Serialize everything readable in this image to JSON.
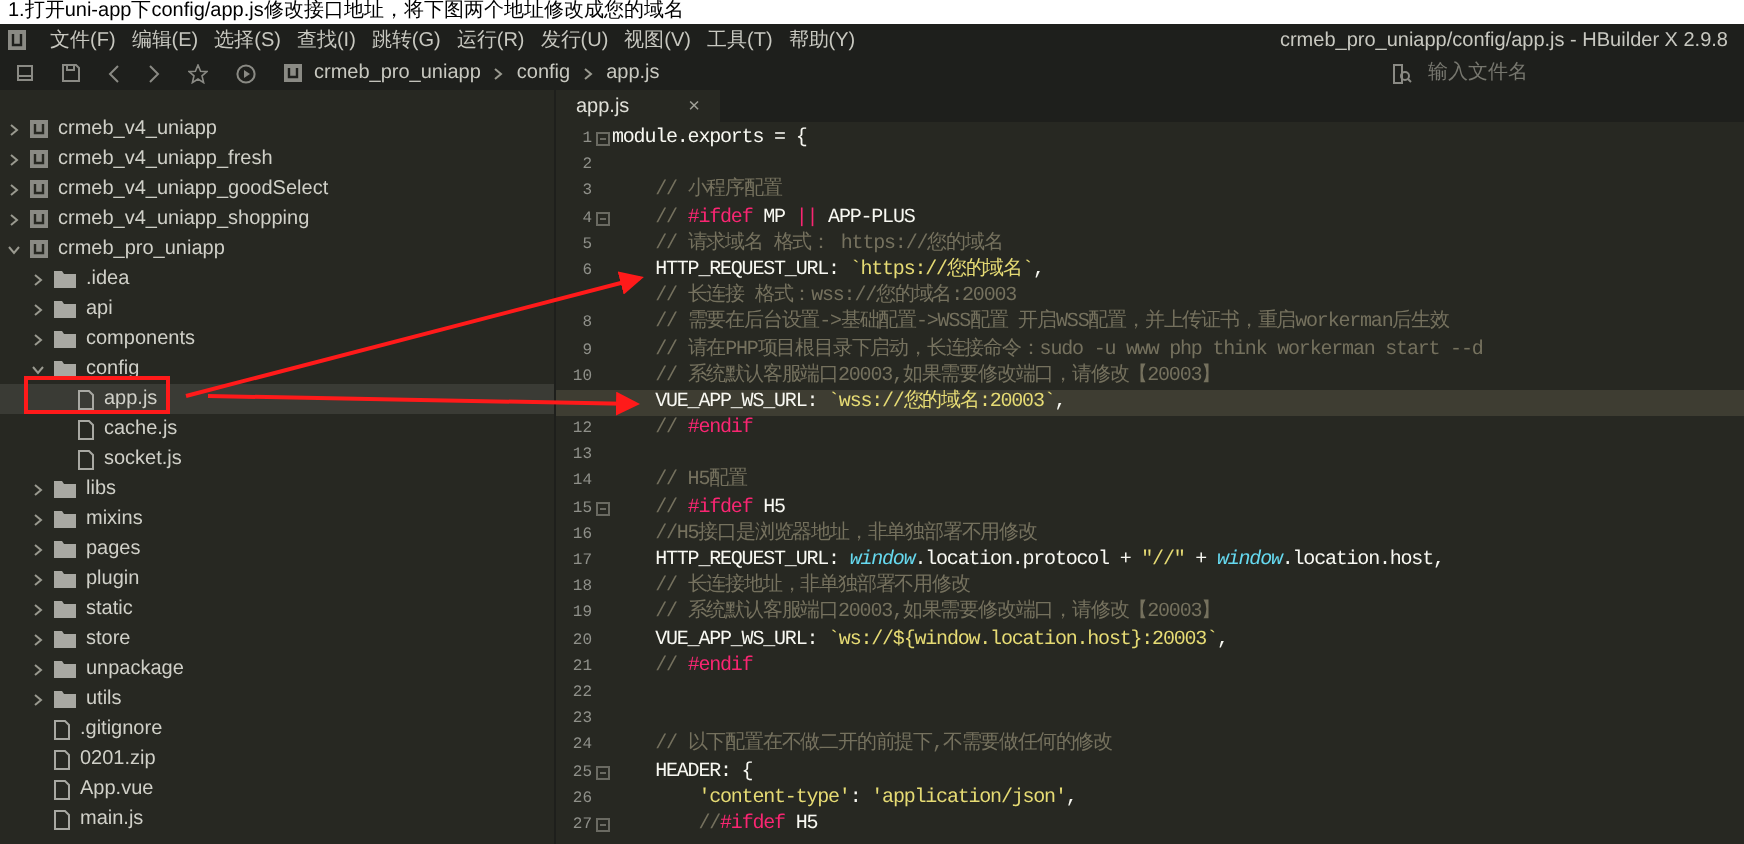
{
  "caption": "1.打开uni-app下config/app.js修改接口地址，将下图两个地址修改成您的域名",
  "menu": [
    "文件(F)",
    "编辑(E)",
    "选择(S)",
    "查找(I)",
    "跳转(G)",
    "运行(R)",
    "发行(U)",
    "视图(V)",
    "工具(T)",
    "帮助(Y)"
  ],
  "window": {
    "title": "crmeb_pro_uniapp/config/app.js - HBuilder X 2.9.8"
  },
  "breadcrumb": [
    "crmeb_pro_uniapp",
    "config",
    "app.js"
  ],
  "file_search": {
    "placeholder": "输入文件名"
  },
  "tree": [
    {
      "kind": "project",
      "label": "crmeb_v4_uniapp",
      "expanded": false,
      "selected": false
    },
    {
      "kind": "project",
      "label": "crmeb_v4_uniapp_fresh",
      "expanded": false,
      "selected": false
    },
    {
      "kind": "project",
      "label": "crmeb_v4_uniapp_goodSelect",
      "expanded": false,
      "selected": false
    },
    {
      "kind": "project",
      "label": "crmeb_v4_uniapp_shopping",
      "expanded": false,
      "selected": false
    },
    {
      "kind": "project",
      "label": "crmeb_pro_uniapp",
      "expanded": true,
      "selected": false,
      "children": [
        {
          "kind": "folder",
          "label": ".idea",
          "expanded": false,
          "selected": false
        },
        {
          "kind": "folder",
          "label": "api",
          "expanded": false,
          "selected": false
        },
        {
          "kind": "folder",
          "label": "components",
          "expanded": false,
          "selected": false
        },
        {
          "kind": "folder",
          "label": "config",
          "expanded": true,
          "selected": false,
          "children": [
            {
              "kind": "file",
              "label": "app.js",
              "selected": true
            },
            {
              "kind": "file",
              "label": "cache.js",
              "selected": false
            },
            {
              "kind": "file",
              "label": "socket.js",
              "selected": false
            }
          ]
        },
        {
          "kind": "folder",
          "label": "libs",
          "expanded": false,
          "selected": false
        },
        {
          "kind": "folder",
          "label": "mixins",
          "expanded": false,
          "selected": false
        },
        {
          "kind": "folder",
          "label": "pages",
          "expanded": false,
          "selected": false
        },
        {
          "kind": "folder",
          "label": "plugin",
          "expanded": false,
          "selected": false
        },
        {
          "kind": "folder",
          "label": "static",
          "expanded": false,
          "selected": false
        },
        {
          "kind": "folder",
          "label": "store",
          "expanded": false,
          "selected": false
        },
        {
          "kind": "folder",
          "label": "unpackage",
          "expanded": false,
          "selected": false
        },
        {
          "kind": "folder",
          "label": "utils",
          "expanded": false,
          "selected": false
        },
        {
          "kind": "file",
          "label": ".gitignore",
          "selected": false
        },
        {
          "kind": "file",
          "label": "0201.zip",
          "selected": false
        },
        {
          "kind": "file",
          "label": "App.vue",
          "selected": false
        },
        {
          "kind": "file",
          "label": "main.js",
          "selected": false
        }
      ]
    }
  ],
  "editor_tab": {
    "label": "app.js",
    "close": "×"
  },
  "lines": [
    {
      "number": "1",
      "foldable": true,
      "current": false,
      "tokens": [
        {
          "kind": "plain",
          "text": "module.exports = {"
        }
      ]
    },
    {
      "number": "2",
      "foldable": false,
      "current": false
    },
    {
      "number": "3",
      "foldable": false,
      "current": false,
      "tokens": [
        {
          "kind": "comment",
          "text": "    // 小程序配置"
        }
      ]
    },
    {
      "number": "4",
      "foldable": true,
      "current": false,
      "tokens": [
        {
          "kind": "comment",
          "text": "    // "
        },
        {
          "kind": "keyword",
          "text": "#ifdef"
        },
        {
          "kind": "plain",
          "text": " MP "
        },
        {
          "kind": "keyword",
          "text": "||"
        },
        {
          "kind": "plain",
          "text": " APP-PLUS"
        }
      ]
    },
    {
      "number": "5",
      "foldable": false,
      "current": false,
      "tokens": [
        {
          "kind": "comment",
          "text": "    // 请求域名 格式： https://您的域名"
        }
      ]
    },
    {
      "number": "6",
      "foldable": false,
      "current": false,
      "tokens": [
        {
          "kind": "plain",
          "text": "    HTTP_REQUEST_URL: "
        },
        {
          "kind": "string",
          "text": "`https://您的域名`"
        },
        {
          "kind": "plain",
          "text": ","
        }
      ]
    },
    {
      "foldable": false,
      "current": false,
      "tokens": [
        {
          "kind": "comment",
          "text": "    // 长连接 格式：wss://您的域名:20003"
        }
      ]
    },
    {
      "number": "8",
      "foldable": false,
      "current": false,
      "tokens": [
        {
          "kind": "comment",
          "text": "    // 需要在后台设置->基础配置->WSS配置 开启WSS配置，并上传证书，重启workerman后生效"
        }
      ]
    },
    {
      "number": "9",
      "foldable": false,
      "current": false,
      "tokens": [
        {
          "kind": "comment",
          "text": "    // 请在PHP项目根目录下启动，长连接命令：sudo -u www php think workerman start --d"
        }
      ]
    },
    {
      "number": "10",
      "foldable": false,
      "current": false,
      "tokens": [
        {
          "kind": "comment",
          "text": "    // 系统默认客服端口20003,如果需要修改端口，请修改【20003】"
        }
      ]
    },
    {
      "foldable": false,
      "current": true,
      "tokens": [
        {
          "kind": "plain",
          "text": "    VUE_APP_WS_URL: "
        },
        {
          "kind": "string",
          "text": "`wss://您的域名:20003`"
        },
        {
          "kind": "plain",
          "text": ","
        }
      ]
    },
    {
      "number": "12",
      "foldable": false,
      "current": false,
      "tokens": [
        {
          "kind": "comment",
          "text": "    // "
        },
        {
          "kind": "keyword",
          "text": "#endif"
        }
      ]
    },
    {
      "number": "13",
      "foldable": false,
      "current": false
    },
    {
      "number": "14",
      "foldable": false,
      "current": false,
      "tokens": [
        {
          "kind": "comment",
          "text": "    // H5配置"
        }
      ]
    },
    {
      "number": "15",
      "foldable": true,
      "current": false,
      "tokens": [
        {
          "kind": "comment",
          "text": "    // "
        },
        {
          "kind": "keyword",
          "text": "#ifdef"
        },
        {
          "kind": "plain",
          "text": " H5"
        }
      ]
    },
    {
      "number": "16",
      "foldable": false,
      "current": false,
      "tokens": [
        {
          "kind": "comment",
          "text": "    //H5接口是浏览器地址，非单独部署不用修改"
        }
      ]
    },
    {
      "number": "17",
      "foldable": false,
      "current": false,
      "tokens": [
        {
          "kind": "plain",
          "text": "    HTTP_REQUEST_URL: "
        },
        {
          "kind": "global",
          "text": "window"
        },
        {
          "kind": "plain",
          "text": ".location.protocol + "
        },
        {
          "kind": "string",
          "text": "\"//\""
        },
        {
          "kind": "plain",
          "text": " + "
        },
        {
          "kind": "global",
          "text": "window"
        },
        {
          "kind": "plain",
          "text": ".location.host,"
        }
      ]
    },
    {
      "number": "18",
      "foldable": false,
      "current": false,
      "tokens": [
        {
          "kind": "comment",
          "text": "    // 长连接地址，非单独部署不用修改"
        }
      ]
    },
    {
      "number": "19",
      "foldable": false,
      "current": false,
      "tokens": [
        {
          "kind": "comment",
          "text": "    // 系统默认客服端口20003,如果需要修改端口，请修改【20003】"
        }
      ]
    },
    {
      "number": "20",
      "foldable": false,
      "current": false,
      "tokens": [
        {
          "kind": "plain",
          "text": "    VUE_APP_WS_URL: "
        },
        {
          "kind": "string",
          "text": "`ws://${window.location.host}:20003`"
        },
        {
          "kind": "plain",
          "text": ","
        }
      ]
    },
    {
      "number": "21",
      "foldable": false,
      "current": false,
      "tokens": [
        {
          "kind": "comment",
          "text": "    // "
        },
        {
          "kind": "keyword",
          "text": "#endif"
        }
      ]
    },
    {
      "number": "22",
      "foldable": false,
      "current": false
    },
    {
      "number": "23",
      "foldable": false,
      "current": false
    },
    {
      "number": "24",
      "foldable": false,
      "current": false,
      "tokens": [
        {
          "kind": "comment",
          "text": "    // 以下配置在不做二开的前提下,不需要做任何的修改"
        }
      ]
    },
    {
      "number": "25",
      "foldable": true,
      "current": false,
      "tokens": [
        {
          "kind": "plain",
          "text": "    HEADER: {"
        }
      ]
    },
    {
      "number": "26",
      "foldable": false,
      "current": false,
      "tokens": [
        {
          "kind": "string",
          "text": "        'content-type'"
        },
        {
          "kind": "plain",
          "text": ": "
        },
        {
          "kind": "string",
          "text": "'application/json'"
        },
        {
          "kind": "plain",
          "text": ","
        }
      ]
    },
    {
      "number": "27",
      "foldable": true,
      "current": false,
      "tokens": [
        {
          "kind": "comment",
          "text": "        //"
        },
        {
          "kind": "keyword",
          "text": "#ifdef"
        },
        {
          "kind": "plain",
          "text": " H5"
        }
      ]
    }
  ]
}
